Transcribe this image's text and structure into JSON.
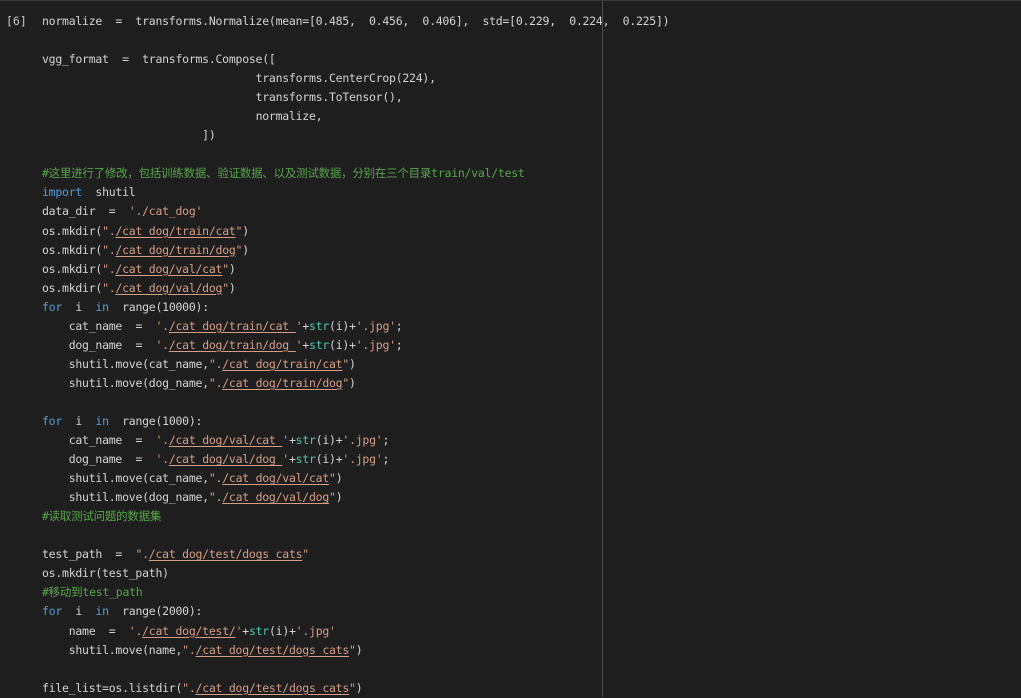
{
  "cell": {
    "prompt": "[6]",
    "lines": [
      {
        "indent": 0,
        "tokens": [
          {
            "t": "normalize  =  transforms.Normalize(mean=[0.485,  0.456,  0.406],  std=[0.229,  0.224,  0.225])",
            "c": ""
          }
        ]
      },
      {
        "indent": 0,
        "tokens": []
      },
      {
        "indent": 0,
        "tokens": [
          {
            "t": "vgg_format  =  transforms.Compose([",
            "c": ""
          }
        ]
      },
      {
        "indent": 32,
        "tokens": [
          {
            "t": "transforms.CenterCrop(224),",
            "c": ""
          }
        ]
      },
      {
        "indent": 32,
        "tokens": [
          {
            "t": "transforms.ToTensor(),",
            "c": ""
          }
        ]
      },
      {
        "indent": 32,
        "tokens": [
          {
            "t": "normalize,",
            "c": ""
          }
        ]
      },
      {
        "indent": 24,
        "tokens": [
          {
            "t": "])",
            "c": ""
          }
        ]
      },
      {
        "indent": 0,
        "tokens": []
      },
      {
        "indent": 0,
        "tokens": [
          {
            "t": "#这里进行了修改，包括训练数据、验证数据、以及测试数据，分别在三个目录train/val/test",
            "c": "cm"
          }
        ]
      },
      {
        "indent": 0,
        "tokens": [
          {
            "t": "import",
            "c": "kw"
          },
          {
            "t": "  shutil",
            "c": ""
          }
        ]
      },
      {
        "indent": 0,
        "tokens": [
          {
            "t": "data_dir  =  ",
            "c": ""
          },
          {
            "t": "'./cat_dog'",
            "c": "str"
          }
        ]
      },
      {
        "indent": 0,
        "tokens": [
          {
            "t": "os.mkdir(",
            "c": ""
          },
          {
            "t": "\".",
            "c": "str"
          },
          {
            "t": "/cat_dog/train/cat",
            "c": "str u"
          },
          {
            "t": "\"",
            "c": "str"
          },
          {
            "t": ")",
            "c": ""
          }
        ]
      },
      {
        "indent": 0,
        "tokens": [
          {
            "t": "os.mkdir(",
            "c": ""
          },
          {
            "t": "\".",
            "c": "str"
          },
          {
            "t": "/cat_dog/train/dog",
            "c": "str u"
          },
          {
            "t": "\"",
            "c": "str"
          },
          {
            "t": ")",
            "c": ""
          }
        ]
      },
      {
        "indent": 0,
        "tokens": [
          {
            "t": "os.mkdir(",
            "c": ""
          },
          {
            "t": "\".",
            "c": "str"
          },
          {
            "t": "/cat_dog/val/cat",
            "c": "str u"
          },
          {
            "t": "\"",
            "c": "str"
          },
          {
            "t": ")",
            "c": ""
          }
        ]
      },
      {
        "indent": 0,
        "tokens": [
          {
            "t": "os.mkdir(",
            "c": ""
          },
          {
            "t": "\".",
            "c": "str"
          },
          {
            "t": "/cat_dog/val/dog",
            "c": "str u"
          },
          {
            "t": "\"",
            "c": "str"
          },
          {
            "t": ")",
            "c": ""
          }
        ]
      },
      {
        "indent": 0,
        "tokens": [
          {
            "t": "for",
            "c": "kw"
          },
          {
            "t": "  i  ",
            "c": ""
          },
          {
            "t": "in",
            "c": "kw"
          },
          {
            "t": "  range(10000):",
            "c": ""
          }
        ]
      },
      {
        "indent": 4,
        "tokens": [
          {
            "t": "cat_name  =  ",
            "c": ""
          },
          {
            "t": "'.",
            "c": "str"
          },
          {
            "t": "/cat_dog/train/cat_",
            "c": "str u"
          },
          {
            "t": "'",
            "c": "str"
          },
          {
            "t": "+",
            "c": ""
          },
          {
            "t": "str",
            "c": "bi"
          },
          {
            "t": "(i)+",
            "c": ""
          },
          {
            "t": "'.jpg'",
            "c": "str"
          },
          {
            "t": ";",
            "c": ""
          }
        ]
      },
      {
        "indent": 4,
        "tokens": [
          {
            "t": "dog_name  =  ",
            "c": ""
          },
          {
            "t": "'.",
            "c": "str"
          },
          {
            "t": "/cat_dog/train/dog_",
            "c": "str u"
          },
          {
            "t": "'",
            "c": "str"
          },
          {
            "t": "+",
            "c": ""
          },
          {
            "t": "str",
            "c": "bi"
          },
          {
            "t": "(i)+",
            "c": ""
          },
          {
            "t": "'.jpg'",
            "c": "str"
          },
          {
            "t": ";",
            "c": ""
          }
        ]
      },
      {
        "indent": 4,
        "tokens": [
          {
            "t": "shutil.move(cat_name,",
            "c": ""
          },
          {
            "t": "\".",
            "c": "str"
          },
          {
            "t": "/cat_dog/train/cat",
            "c": "str u"
          },
          {
            "t": "\"",
            "c": "str"
          },
          {
            "t": ")",
            "c": ""
          }
        ]
      },
      {
        "indent": 4,
        "tokens": [
          {
            "t": "shutil.move(dog_name,",
            "c": ""
          },
          {
            "t": "\".",
            "c": "str"
          },
          {
            "t": "/cat_dog/train/dog",
            "c": "str u"
          },
          {
            "t": "\"",
            "c": "str"
          },
          {
            "t": ")",
            "c": ""
          }
        ]
      },
      {
        "indent": 0,
        "tokens": []
      },
      {
        "indent": 0,
        "tokens": [
          {
            "t": "for",
            "c": "kw"
          },
          {
            "t": "  i  ",
            "c": ""
          },
          {
            "t": "in",
            "c": "kw"
          },
          {
            "t": "  range(1000):",
            "c": ""
          }
        ]
      },
      {
        "indent": 4,
        "tokens": [
          {
            "t": "cat_name  =  ",
            "c": ""
          },
          {
            "t": "'.",
            "c": "str"
          },
          {
            "t": "/cat_dog/val/cat_",
            "c": "str u"
          },
          {
            "t": "'",
            "c": "str"
          },
          {
            "t": "+",
            "c": ""
          },
          {
            "t": "str",
            "c": "bi"
          },
          {
            "t": "(i)+",
            "c": ""
          },
          {
            "t": "'.jpg'",
            "c": "str"
          },
          {
            "t": ";",
            "c": ""
          }
        ]
      },
      {
        "indent": 4,
        "tokens": [
          {
            "t": "dog_name  =  ",
            "c": ""
          },
          {
            "t": "'.",
            "c": "str"
          },
          {
            "t": "/cat_dog/val/dog_",
            "c": "str u"
          },
          {
            "t": "'",
            "c": "str"
          },
          {
            "t": "+",
            "c": ""
          },
          {
            "t": "str",
            "c": "bi"
          },
          {
            "t": "(i)+",
            "c": ""
          },
          {
            "t": "'.jpg'",
            "c": "str"
          },
          {
            "t": ";",
            "c": ""
          }
        ]
      },
      {
        "indent": 4,
        "tokens": [
          {
            "t": "shutil.move(cat_name,",
            "c": ""
          },
          {
            "t": "\".",
            "c": "str"
          },
          {
            "t": "/cat_dog/val/cat",
            "c": "str u"
          },
          {
            "t": "\"",
            "c": "str"
          },
          {
            "t": ")",
            "c": ""
          }
        ]
      },
      {
        "indent": 4,
        "tokens": [
          {
            "t": "shutil.move(dog_name,",
            "c": ""
          },
          {
            "t": "\".",
            "c": "str"
          },
          {
            "t": "/cat_dog/val/dog",
            "c": "str u"
          },
          {
            "t": "\"",
            "c": "str"
          },
          {
            "t": ")",
            "c": ""
          }
        ]
      },
      {
        "indent": 0,
        "tokens": [
          {
            "t": "#读取测试问题的数据集",
            "c": "cm"
          }
        ]
      },
      {
        "indent": 0,
        "tokens": []
      },
      {
        "indent": 0,
        "tokens": [
          {
            "t": "test_path  =  ",
            "c": ""
          },
          {
            "t": "\".",
            "c": "str"
          },
          {
            "t": "/cat_dog/test/dogs_cats",
            "c": "str u"
          },
          {
            "t": "\"",
            "c": "str"
          }
        ]
      },
      {
        "indent": 0,
        "tokens": [
          {
            "t": "os.mkdir(test_path)",
            "c": ""
          }
        ]
      },
      {
        "indent": 0,
        "tokens": [
          {
            "t": "#移动到test_path",
            "c": "cm"
          }
        ]
      },
      {
        "indent": 0,
        "tokens": [
          {
            "t": "for",
            "c": "kw"
          },
          {
            "t": "  i  ",
            "c": ""
          },
          {
            "t": "in",
            "c": "kw"
          },
          {
            "t": "  range(2000):",
            "c": ""
          }
        ]
      },
      {
        "indent": 4,
        "tokens": [
          {
            "t": "name  =  ",
            "c": ""
          },
          {
            "t": "'.",
            "c": "str"
          },
          {
            "t": "/cat_dog/test/",
            "c": "str u"
          },
          {
            "t": "'",
            "c": "str"
          },
          {
            "t": "+",
            "c": ""
          },
          {
            "t": "str",
            "c": "bi"
          },
          {
            "t": "(i)+",
            "c": ""
          },
          {
            "t": "'.jpg'",
            "c": "str"
          }
        ]
      },
      {
        "indent": 4,
        "tokens": [
          {
            "t": "shutil.move(name,",
            "c": ""
          },
          {
            "t": "\".",
            "c": "str"
          },
          {
            "t": "/cat_dog/test/dogs_cats",
            "c": "str u"
          },
          {
            "t": "\"",
            "c": "str"
          },
          {
            "t": ")",
            "c": ""
          }
        ]
      },
      {
        "indent": 0,
        "tokens": []
      },
      {
        "indent": 0,
        "tokens": [
          {
            "t": "file_list=os.listdir(",
            "c": ""
          },
          {
            "t": "\".",
            "c": "str"
          },
          {
            "t": "/cat_dog/test/dogs_cats",
            "c": "str u"
          },
          {
            "t": "\"",
            "c": "str"
          },
          {
            "t": ")",
            "c": ""
          }
        ]
      }
    ]
  },
  "colors": {
    "background": "#1e1e1e",
    "text": "#d4d4d4",
    "keyword": "#569cd6",
    "builtin": "#4ec9b0",
    "comment": "#57a64a",
    "string": "#d69d85"
  }
}
